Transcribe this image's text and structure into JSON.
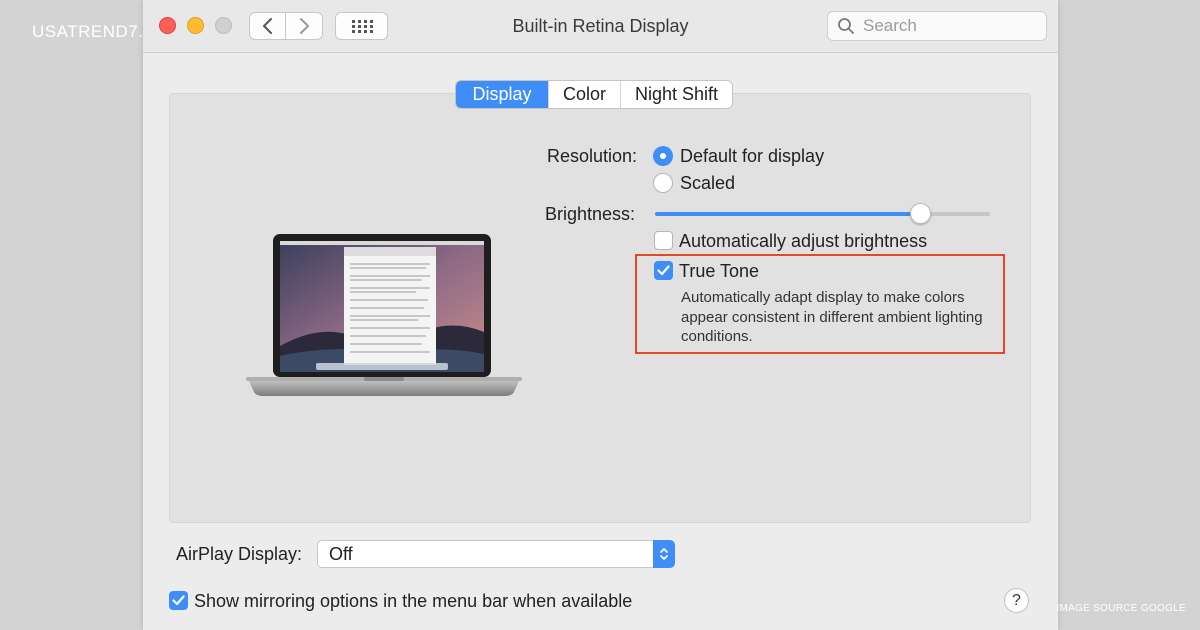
{
  "watermark": {
    "left": "USATREND7.",
    "right": "IMAGE SOURCE GOOGLE"
  },
  "window": {
    "title": "Built-in Retina Display",
    "search_placeholder": "Search"
  },
  "tabs": [
    {
      "label": "Display",
      "active": true
    },
    {
      "label": "Color",
      "active": false
    },
    {
      "label": "Night Shift",
      "active": false
    }
  ],
  "settings": {
    "resolution_label": "Resolution:",
    "resolution_options": [
      {
        "label": "Default for display",
        "selected": true
      },
      {
        "label": "Scaled",
        "selected": false
      }
    ],
    "brightness_label": "Brightness:",
    "brightness_level": 0.79,
    "auto_brightness": {
      "label": "Automatically adjust brightness",
      "checked": false
    },
    "true_tone": {
      "label": "True Tone",
      "checked": true,
      "description": "Automatically adapt display to make colors appear consistent in different ambient lighting conditions."
    }
  },
  "airplay": {
    "label": "AirPlay Display:",
    "value": "Off"
  },
  "mirroring": {
    "label": "Show mirroring options in the menu bar when available",
    "checked": true
  },
  "help": {
    "label": "?"
  },
  "colors": {
    "accent": "#3f8ef8",
    "highlight_border": "#e4472e"
  },
  "icons": [
    "chevron-left-icon",
    "chevron-right-icon",
    "grid-icon",
    "search-icon",
    "checkmark-icon",
    "up-down-arrows-icon"
  ]
}
